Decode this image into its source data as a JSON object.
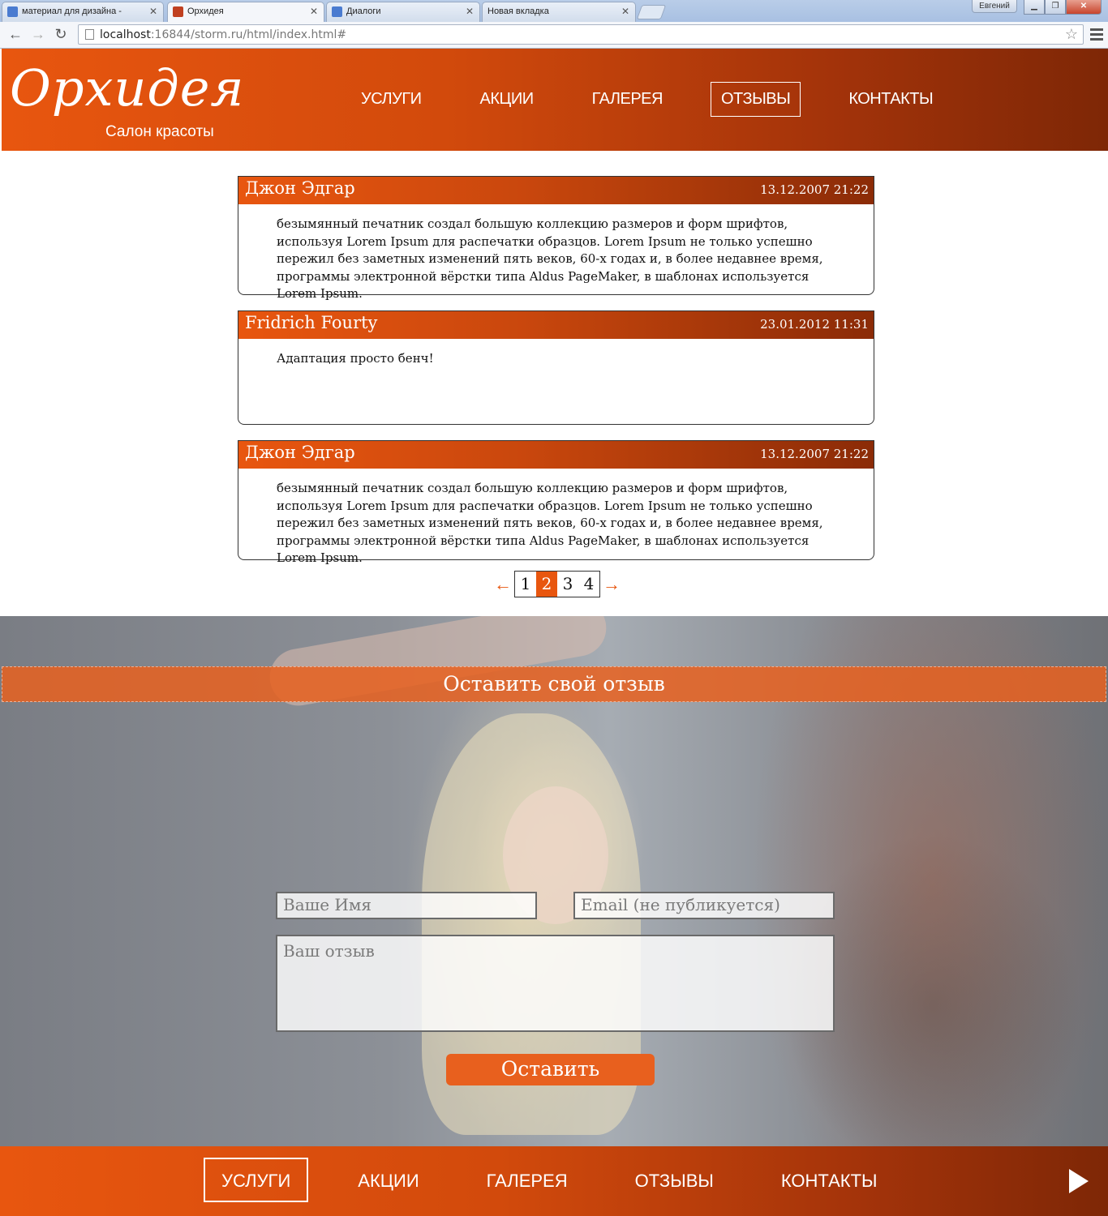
{
  "browser": {
    "tabs": [
      {
        "title": "материал для дизайна - ",
        "favicon_color": "#4a7bd0"
      },
      {
        "title": "Орхидея",
        "favicon_color": "#c04020"
      },
      {
        "title": "Диалоги",
        "favicon_color": "#4a7bd0"
      },
      {
        "title": "Новая вкладка",
        "favicon_color": ""
      }
    ],
    "user": "Евгений",
    "url_host": "localhost",
    "url_rest": ":16844/storm.ru/html/index.html#"
  },
  "header": {
    "logo_script": "Орхидея",
    "logo_tag": "Салон красоты",
    "nav": [
      "УСЛУГИ",
      "АКЦИИ",
      "ГАЛЕРЕЯ",
      "ОТЗЫВЫ",
      "КОНТАКТЫ"
    ],
    "active": "ОТЗЫВЫ"
  },
  "reviews": [
    {
      "author": "Джон Эдгар",
      "date": "13.12.2007 21:22",
      "text": "безымянный печатник создал большую коллекцию размеров и форм шрифтов, используя Lorem Ipsum для распечатки образцов. Lorem Ipsum не только успешно пережил без заметных изменений пять веков, 60-х годах и, в более недавнее время, программы электронной вёрстки типа Aldus PageMaker, в шаблонах используется Lorem Ipsum."
    },
    {
      "author": "Fridrich Fourty",
      "date": "23.01.2012 11:31",
      "text": "Адаптация просто бенч!"
    },
    {
      "author": "Джон Эдгар",
      "date": "13.12.2007 21:22",
      "text": "безымянный печатник создал большую коллекцию размеров и форм шрифтов, используя Lorem Ipsum для распечатки образцов. Lorem Ipsum не только успешно пережил без заметных изменений пять веков, 60-х годах и, в более недавнее время, программы электронной вёрстки типа Aldus PageMaker, в шаблонах используется Lorem Ipsum."
    }
  ],
  "pagination": {
    "prev": "←",
    "next": "→",
    "pages": [
      "1",
      "2",
      "3",
      "4"
    ],
    "current": "2"
  },
  "feedback": {
    "title": "Оставить свой отзыв",
    "name_placeholder": "Ваше Имя",
    "email_placeholder": "Email (не публикуется)",
    "review_placeholder": "Ваш отзыв",
    "submit": "Оставить"
  },
  "footer": {
    "nav": [
      "УСЛУГИ",
      "АКЦИИ",
      "ГАЛЕРЕЯ",
      "ОТЗЫВЫ",
      "КОНТАКТЫ"
    ],
    "active": "УСЛУГИ"
  },
  "colors": {
    "accent": "#e8560f",
    "accent_dark": "#7e2706"
  }
}
